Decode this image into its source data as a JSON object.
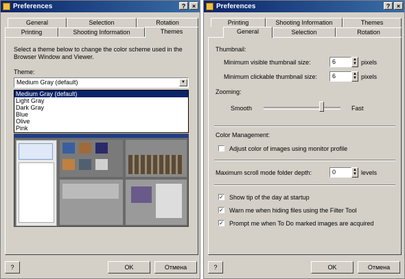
{
  "window_title": "Preferences",
  "title_buttons": {
    "help": "?",
    "close": "×"
  },
  "left": {
    "tabs_row1": [
      "General",
      "Selection",
      "Rotation"
    ],
    "tabs_row2": [
      "Printing",
      "Shooting Information",
      "Themes"
    ],
    "intro": "Select a theme below to change the color scheme used in the Browser Window and Viewer.",
    "theme_label": "Theme:",
    "theme_selected": "Medium Gray (default)",
    "theme_options": [
      "Medium Gray (default)",
      "Light Gray",
      "Dark Gray",
      "Blue",
      "Olive",
      "Pink"
    ],
    "help_button": "?",
    "ok_button": "OK",
    "cancel_button": "Отмена"
  },
  "right": {
    "tabs_row1": [
      "Printing",
      "Shooting Information",
      "Themes"
    ],
    "tabs_row2": [
      "General",
      "Selection",
      "Rotation"
    ],
    "thumbnail_heading": "Thumbnail:",
    "min_visible_label": "Minimum visible thumbnail size:",
    "min_visible_value": "6",
    "min_visible_unit": "pixels",
    "min_clickable_label": "Minimum clickable thumbnail size:",
    "min_clickable_value": "6",
    "min_clickable_unit": "pixels",
    "zooming_heading": "Zooming:",
    "zoom_smooth": "Smooth",
    "zoom_fast": "Fast",
    "zoom_level": 0.75,
    "color_mgmt_heading": "Color Management:",
    "color_mgmt_check": "Adjust color of images using monitor profile",
    "color_mgmt_checked": false,
    "scroll_depth_label": "Maximum scroll mode folder depth:",
    "scroll_depth_value": "0",
    "scroll_depth_unit": "levels",
    "opt_tip": "Show tip of the day at startup",
    "opt_tip_checked": true,
    "opt_filter": "Warn me when hiding files using the Filter Tool",
    "opt_filter_checked": true,
    "opt_todo": "Prompt me when To Do marked images are acquired",
    "opt_todo_checked": true,
    "help_button": "?",
    "ok_button": "OK",
    "cancel_button": "Отмена"
  }
}
